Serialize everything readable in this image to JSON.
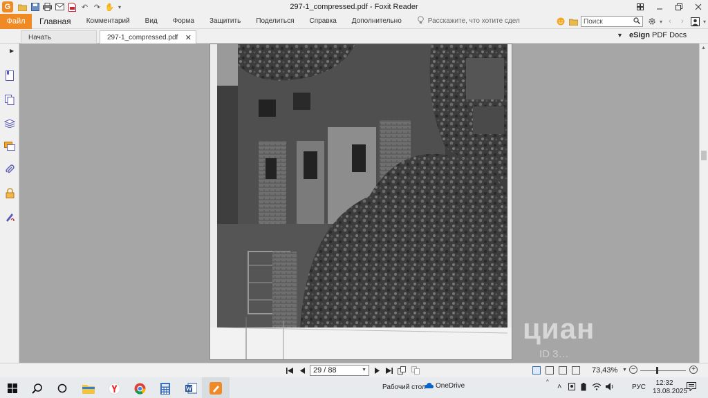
{
  "window": {
    "title": "297-1_compressed.pdf - Foxit Reader",
    "app_logo_letter": "G"
  },
  "ribbon": {
    "file_tab": "Файл",
    "tabs": [
      "Главная",
      "Комментарий",
      "Вид",
      "Форма",
      "Защитить",
      "Поделиться",
      "Справка",
      "Дополнительно"
    ],
    "tell_me": "Расскажите, что хотите сдел",
    "search_placeholder": "Поиск"
  },
  "doc_tabs": {
    "start": "Начать",
    "document": "297-1_compressed.pdf"
  },
  "esign": {
    "brand": "eSign",
    "label": "PDF Docs"
  },
  "statusbar": {
    "page_indicator": "29 / 88",
    "zoom": "73,43%"
  },
  "taskbar": {
    "desktop_label": "Рабочий стол",
    "onedrive_label": "OneDrive",
    "lang": "РУС",
    "time": "12:32",
    "date": "13.08.2025"
  },
  "watermark": {
    "brand": "циан",
    "id": "ID 3…"
  },
  "colors": {
    "accent": "#f08a24",
    "background": "#a6a6a6",
    "chrome": "#f0f0f0"
  }
}
